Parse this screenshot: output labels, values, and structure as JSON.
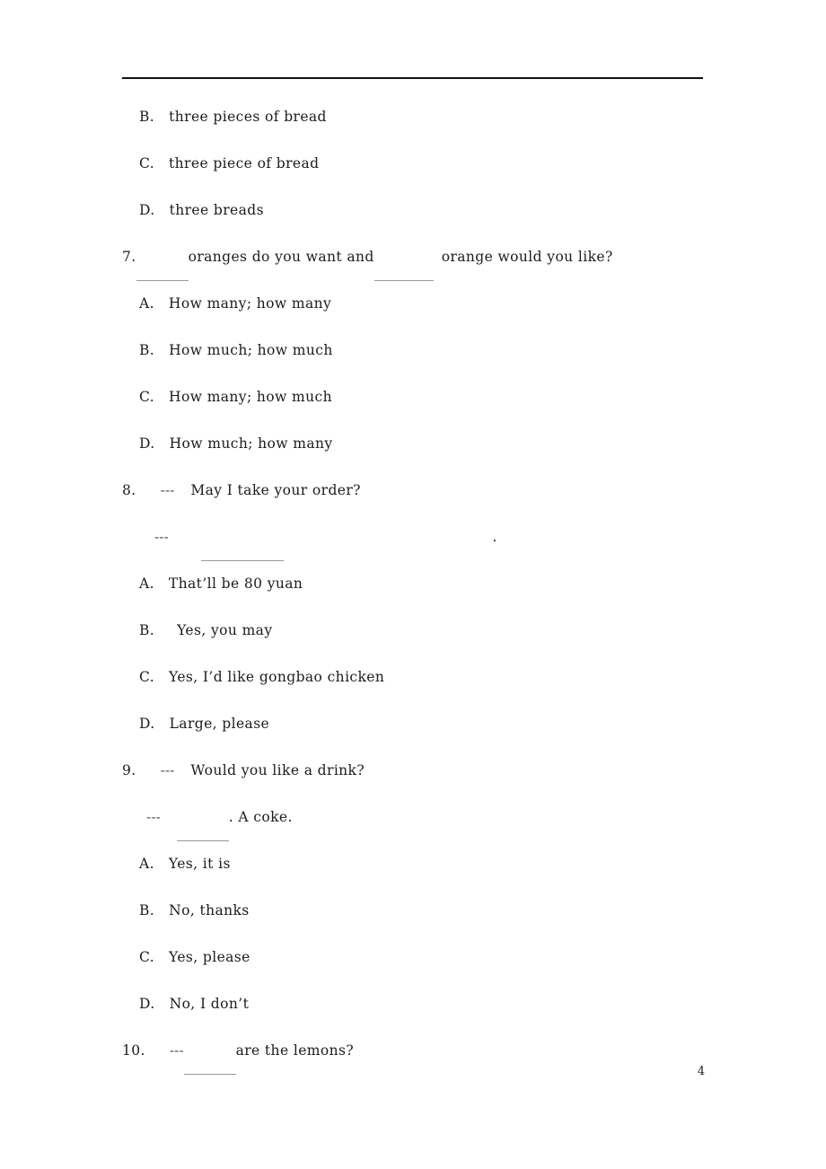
{
  "document": {
    "page_number": "4",
    "rule_color": "#111111",
    "text_color": "#1c1c1c",
    "blank_color": "#9a9a9a",
    "dash_mark": "---"
  },
  "questions": [
    {
      "id": "q6-cont",
      "options": [
        {
          "label": "B.",
          "text": "three  pieces  of  bread"
        },
        {
          "label": "C.",
          "text": "three  piece  of  bread"
        },
        {
          "label": "D.",
          "text": "three  breads"
        }
      ]
    },
    {
      "id": "q7",
      "number": "7.",
      "stem_part_1": "oranges  do  you  want  and",
      "stem_part_2": "orange  would  you  like?",
      "options": [
        {
          "label": "A.",
          "text": "How  many;  how  many"
        },
        {
          "label": "B.",
          "text": "How  much;  how  much"
        },
        {
          "label": "C.",
          "text": "How  many;  how  much"
        },
        {
          "label": "D.",
          "text": "How  much;  how  many"
        }
      ]
    },
    {
      "id": "q8",
      "number": "8.",
      "prompt": "May  I  take  your  order?",
      "answer_period": ".",
      "options": [
        {
          "label": "A.",
          "text": "That’ll  be  80  yuan"
        },
        {
          "label": "B.",
          "text": "Yes,  you  may"
        },
        {
          "label": "C.",
          "text": "Yes,  I’d  like  gongbao  chicken"
        },
        {
          "label": "D.",
          "text": "Large,  please"
        }
      ]
    },
    {
      "id": "q9",
      "number": "9.",
      "prompt": "Would  you  like  a  drink?",
      "answer_tail": ".  A  coke.",
      "options": [
        {
          "label": "A.",
          "text": "Yes,  it  is"
        },
        {
          "label": "B.",
          "text": "No,  thanks"
        },
        {
          "label": "C.",
          "text": "Yes,  please"
        },
        {
          "label": "D.",
          "text": "No,  I  don’t"
        }
      ]
    },
    {
      "id": "q10",
      "number": "10.",
      "stem_tail": "are  the  lemons?"
    }
  ]
}
